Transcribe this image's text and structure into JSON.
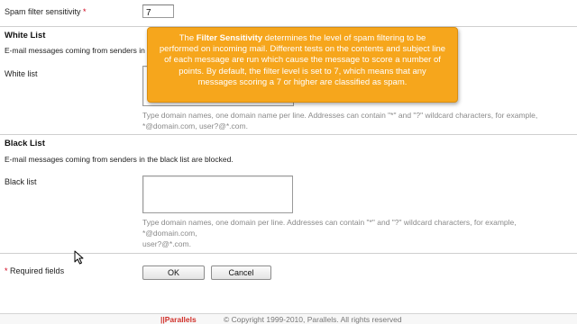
{
  "spam_sensitivity": {
    "label": "Spam filter sensitivity",
    "required_mark": "*",
    "value": "7"
  },
  "white_list": {
    "title": "White List",
    "description": "E-mail messages coming from senders in the",
    "field_label": "White list",
    "hint_line1": "Type domain names, one domain name per line. Addresses can contain \"*\" and \"?\" wildcard characters, for example,",
    "hint_line2": "*@domain.com, user?@*.com."
  },
  "black_list": {
    "title": "Black List",
    "description": "E-mail messages coming from senders in the black list are blocked.",
    "field_label": "Black list",
    "hint_line1": "Type domain names, one domain per line. Addresses can contain \"*\" and \"?\" wildcard characters, for example, *@domain.com,",
    "hint_line2": "user?@*.com."
  },
  "tooltip": {
    "lead": "The ",
    "term": "Filter Sensitivity",
    "text": " determines the level of spam filtering to be performed on incoming mail. Different tests on the contents and subject line of each message are run which cause the message to score a number of points. By default, the filter level is set to 7, which means that any messages scoring a 7 or higher are classified as spam."
  },
  "form": {
    "required_note": "Required fields",
    "required_mark": "*",
    "ok_label": "OK",
    "cancel_label": "Cancel"
  },
  "footer": {
    "brand": "||Parallels",
    "copyright": "© Copyright 1999-2010, Parallels. All rights reserved"
  },
  "colors": {
    "tooltip_bg": "#f6a61c",
    "required": "#d0021b",
    "brand": "#d1312b"
  }
}
